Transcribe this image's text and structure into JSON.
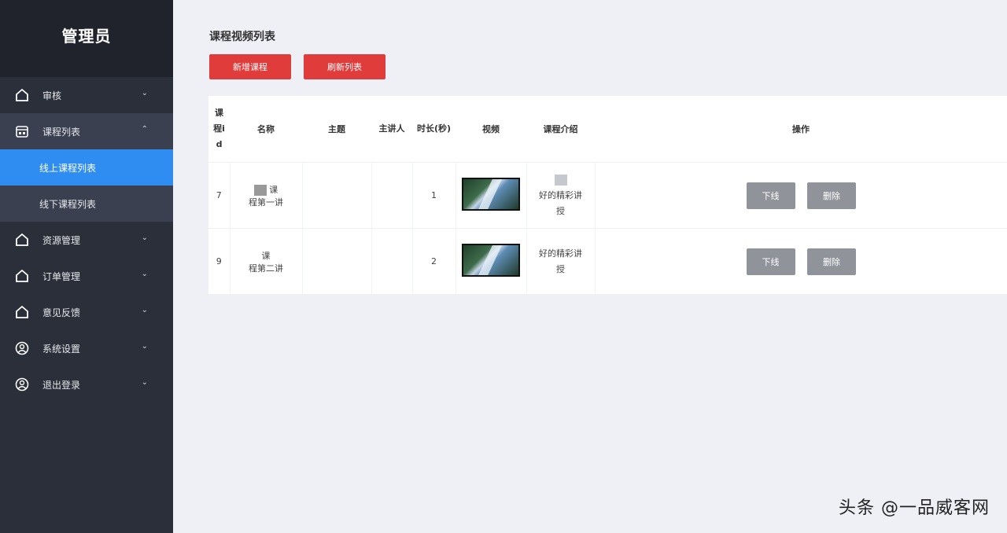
{
  "brand": {
    "title": "管理员",
    "subtitle": ""
  },
  "menu": [
    {
      "label": "审核",
      "icon": "home-icon",
      "arrow": "⌄"
    },
    {
      "label": "课程列表",
      "icon": "calendar-icon",
      "arrow": "⌃",
      "children": [
        {
          "label": "线上课程列表",
          "active": true
        },
        {
          "label": "线下课程列表",
          "active": false
        }
      ]
    },
    {
      "label": "资源管理",
      "icon": "home-icon",
      "arrow": "⌄"
    },
    {
      "label": "订单管理",
      "icon": "home-icon",
      "arrow": "⌄"
    },
    {
      "label": "意见反馈",
      "icon": "home-icon",
      "arrow": "⌄"
    },
    {
      "label": "系统设置",
      "icon": "user-circle-icon",
      "arrow": "⌄"
    },
    {
      "label": "退出登录",
      "icon": "user-circle-icon",
      "arrow": "⌄"
    }
  ],
  "page": {
    "title": "课程视频列表",
    "add_button": "新增课程",
    "refresh_button": "刷新列表"
  },
  "table": {
    "columns": [
      "课程id",
      "名称",
      "主题",
      "主讲人",
      "时长(秒)",
      "视频",
      "课程介绍",
      "操作"
    ],
    "rows": [
      {
        "id": "7",
        "name_line1": "课",
        "name_line2": "程第一讲",
        "theme": "",
        "speaker": "",
        "duration": "1",
        "intro_line1": "好的精彩讲",
        "intro_line2": "授"
      },
      {
        "id": "9",
        "name_line1": "课",
        "name_line2": "程第二讲",
        "theme": "",
        "speaker": "",
        "duration": "2",
        "intro_line1": "好的精彩讲",
        "intro_line2": "授"
      }
    ],
    "action_offline": "下线",
    "action_delete": "删除"
  },
  "watermark": "头条 @一品威客网",
  "colors": {
    "sidebar": "#2b2f3a",
    "active": "#2f8cf0",
    "primary_button": "#e13c3c",
    "action_button": "#909399"
  }
}
